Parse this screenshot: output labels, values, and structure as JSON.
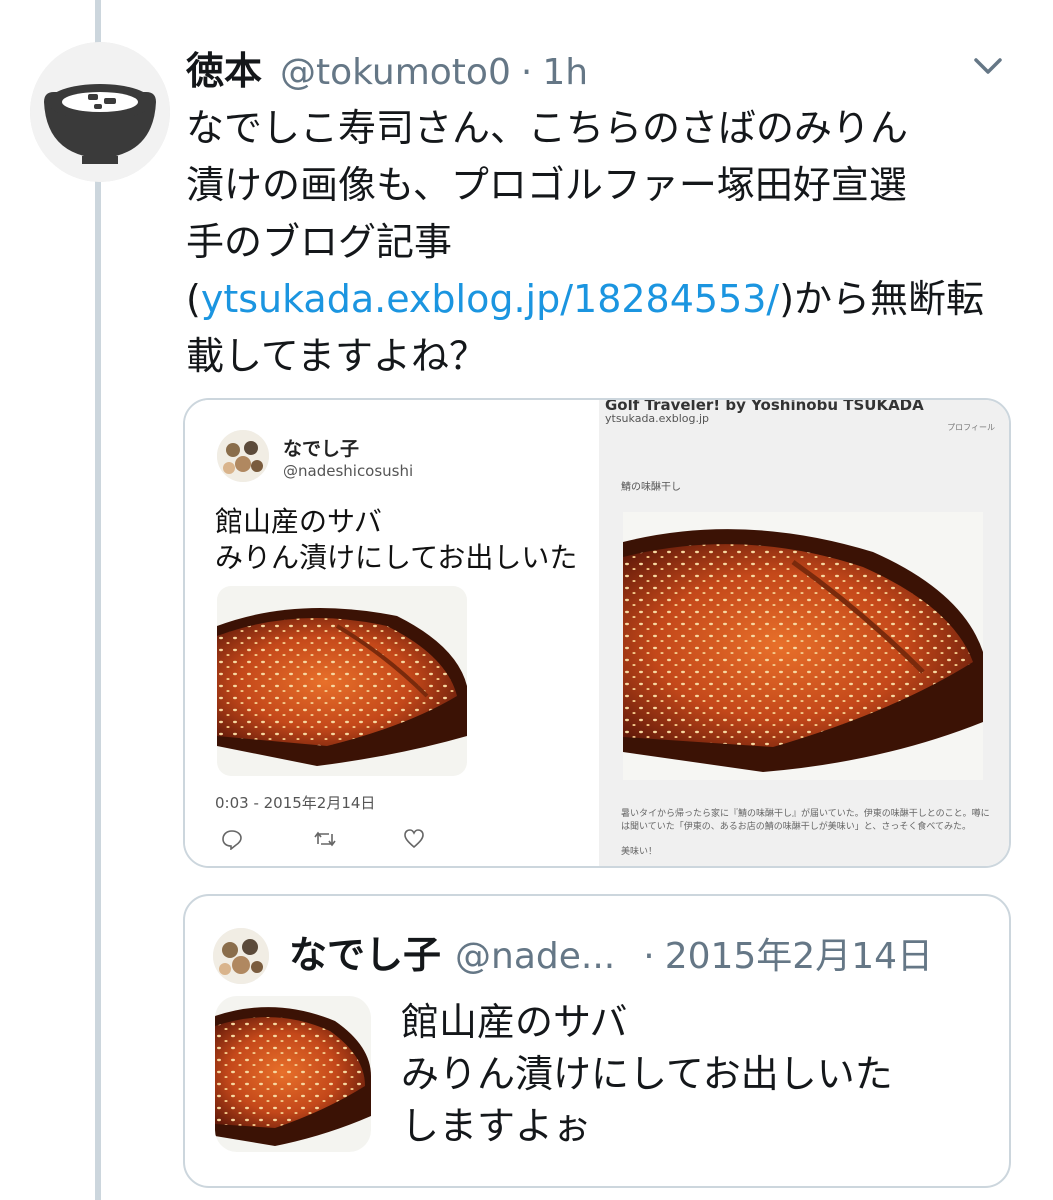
{
  "tweet": {
    "display_name": "徳本",
    "handle": "@tokumoto0",
    "separator": "·",
    "time": "1h",
    "avatar_icon": "bowl-logo-icon",
    "menu_icon": "chevron-down-icon",
    "text_lines": [
      "なでしこ寿司さん、こちらのさばのみりん",
      "漬けの画像も、プロゴルファー塚田好宣選",
      "手のブログ記事"
    ],
    "paren_open": "(",
    "link_text": "ytsukada.exblog.jp/18284553/",
    "after_link": ")から無断転",
    "last_line": "載してますよね？"
  },
  "media": {
    "left_panel": {
      "display_name": "なでし子",
      "handle": "@nadeshicosushi",
      "text_line1": "館山産のサバ",
      "text_line2": "みりん漬けにしてお出しいた",
      "timestamp": "0:03 - 2015年2月14日",
      "actions": [
        "reply-icon",
        "retweet-icon",
        "like-icon"
      ]
    },
    "right_panel": {
      "blog_title": "Golf Traveler! by Yoshinobu TSUKADA",
      "blog_url": "ytsukada.exblog.jp",
      "corner_label": "プロフィール",
      "post_title": "鯖の味醂干し",
      "caption": "暑いタイから帰ったら家に『鯖の味醂干し』が届いていた。伊東の味醂干しとのこと。噂には聞いていた「伊東の、あるお店の鯖の味醂干しが美味い」と、さっそく食べてみた。",
      "caption2": "美味い！"
    }
  },
  "quoted": {
    "display_name": "なでし子",
    "handle": "@nade...",
    "separator": "·",
    "date": "2015年2月14日",
    "text_lines": [
      "館山産のサバ",
      "みりん漬けにしてお出しいた",
      "しますよぉ"
    ]
  },
  "colors": {
    "link": "#1b95e0",
    "secondary_text": "#657786",
    "border": "#ccd6dd",
    "thread_line": "#ccd6dd"
  }
}
